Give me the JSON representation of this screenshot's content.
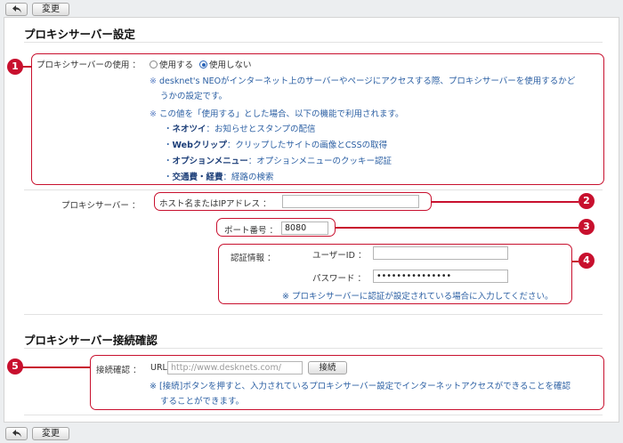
{
  "toolbar": {
    "change_label": "変更"
  },
  "section1": {
    "title": "プロキシサーバー設定",
    "usage": {
      "label": "プロキシサーバーの使用 ：",
      "option_use": "使用する",
      "option_nouse": "使用しない",
      "selected": "使用しない",
      "note_mark": "※",
      "note1_line1": "desknet's NEOがインターネット上のサーバーやページにアクセスする際、プロキシサーバーを使用するかど",
      "note1_line2": "うかの設定です。",
      "note2": "この値を「使用する」とした場合、以下の機能で利用されます。",
      "features": [
        {
          "name": "ネオツイ",
          "desc": "：お知らせとスタンプの配信"
        },
        {
          "name": "Webクリップ",
          "desc": "：クリップしたサイトの画像とCSSの取得"
        },
        {
          "name": "オプションメニュー",
          "desc": "：オプションメニューのクッキー認証"
        },
        {
          "name": "交通費・経費",
          "desc": "：経路の検索"
        }
      ]
    },
    "proxy": {
      "label": "プロキシサーバー ：",
      "host_label": "ホスト名またはIPアドレス ：",
      "host_value": "",
      "port_label": "ポート番号 ：",
      "port_value": "8080",
      "auth_label": "認証情報 ：",
      "user_label": "ユーザーID ：",
      "user_value": "",
      "password_label": "パスワード ：",
      "password_value": "•••••••••••••••",
      "auth_note": "※ プロキシサーバーに認証が設定されている場合に入力してください。"
    }
  },
  "section2": {
    "title": "プロキシサーバー接続確認",
    "check_label": "接続確認 ：",
    "url_label": "URL",
    "url_placeholder": "http://www.desknets.com/",
    "connect_label": "接続",
    "note_line1": "※ [接続]ボタンを押すと、入力されているプロキシサーバー設定でインターネットアクセスができることを確認",
    "note_line2": "することができます。"
  },
  "badges": [
    "1",
    "2",
    "3",
    "4",
    "5"
  ],
  "colors": {
    "callout": "#c8102e",
    "note_text": "#2b5fa3",
    "background": "#eceef0"
  }
}
